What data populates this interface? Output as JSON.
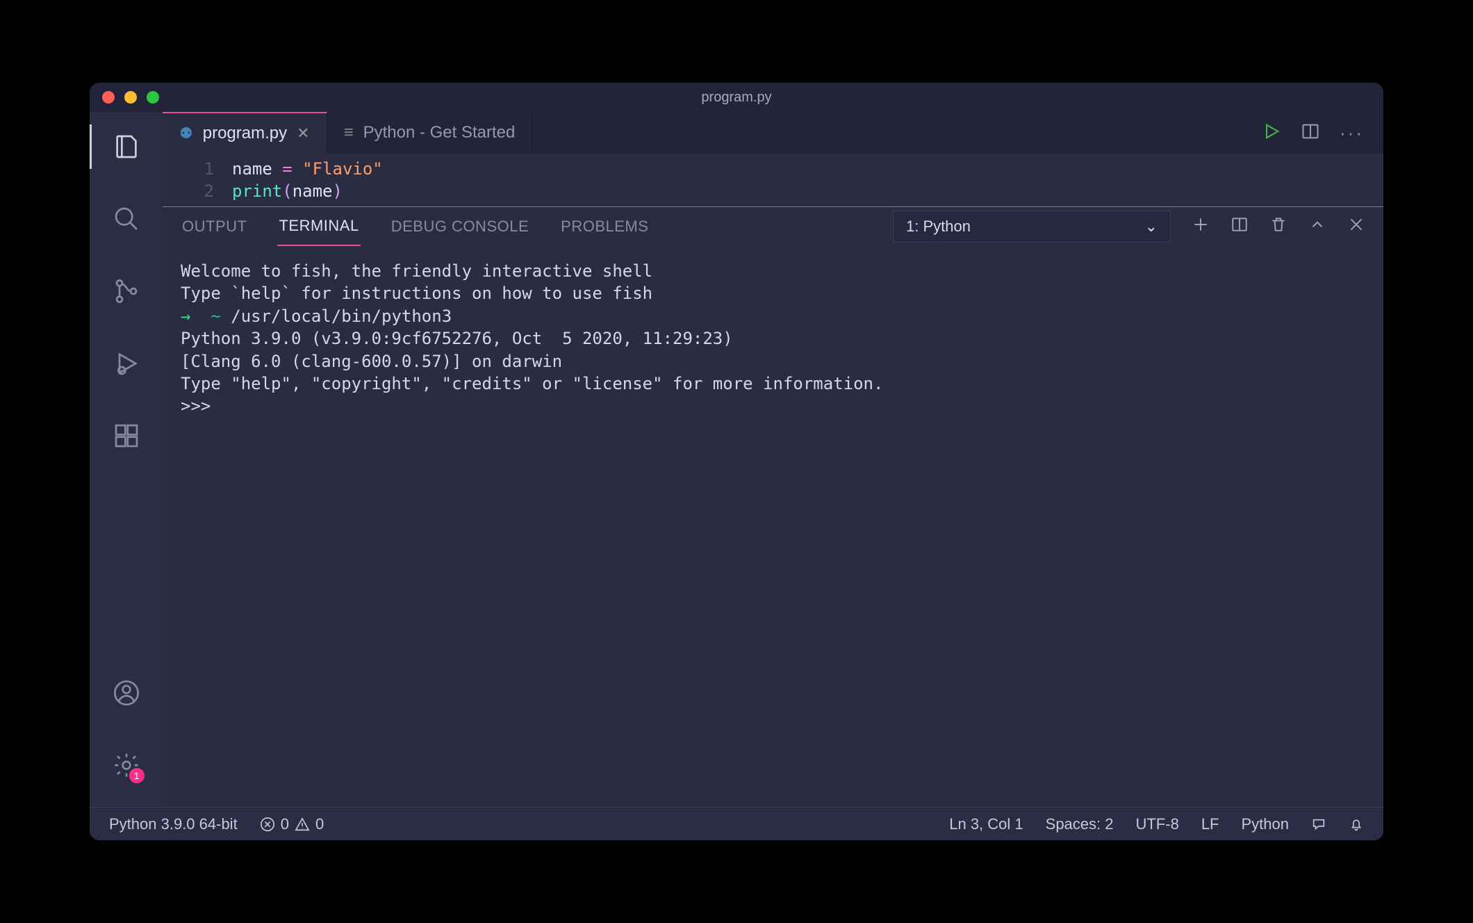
{
  "titlebar": {
    "title": "program.py"
  },
  "activity": {
    "items": [
      {
        "name": "explorer",
        "active": true
      },
      {
        "name": "search"
      },
      {
        "name": "source-control"
      },
      {
        "name": "run-debug"
      },
      {
        "name": "extensions"
      }
    ],
    "bottom": [
      {
        "name": "account"
      },
      {
        "name": "settings",
        "badge": "1"
      }
    ]
  },
  "tabs": [
    {
      "label": "program.py",
      "active": true,
      "icon": "python"
    },
    {
      "label": "Python - Get Started",
      "active": false,
      "icon": "lines"
    }
  ],
  "editor": {
    "lines": [
      {
        "num": "1",
        "tokens": [
          {
            "t": "var",
            "v": "name"
          },
          {
            "t": "op",
            "v": " = "
          },
          {
            "t": "str",
            "v": "\"Flavio\""
          }
        ]
      },
      {
        "num": "2",
        "tokens": [
          {
            "t": "fn",
            "v": "print"
          },
          {
            "t": "p",
            "v": "("
          },
          {
            "t": "var",
            "v": "name"
          },
          {
            "t": "p",
            "v": ")"
          }
        ]
      }
    ]
  },
  "panel": {
    "tabs": [
      "OUTPUT",
      "TERMINAL",
      "DEBUG CONSOLE",
      "PROBLEMS"
    ],
    "active": "TERMINAL",
    "selector": "1: Python"
  },
  "terminal": {
    "lines": [
      "Welcome to fish, the friendly interactive shell",
      "Type `help` for instructions on how to use fish",
      {
        "prompt": "→",
        "cwd": "~",
        "cmd": "/usr/local/bin/python3"
      },
      "Python 3.9.0 (v3.9.0:9cf6752276, Oct  5 2020, 11:29:23)",
      "[Clang 6.0 (clang-600.0.57)] on darwin",
      "Type \"help\", \"copyright\", \"credits\" or \"license\" for more information.",
      ">>>"
    ]
  },
  "status": {
    "python": "Python 3.9.0 64-bit",
    "errors": "0",
    "warnings": "0",
    "cursor": "Ln 3, Col 1",
    "spaces": "Spaces: 2",
    "encoding": "UTF-8",
    "eol": "LF",
    "lang": "Python"
  }
}
